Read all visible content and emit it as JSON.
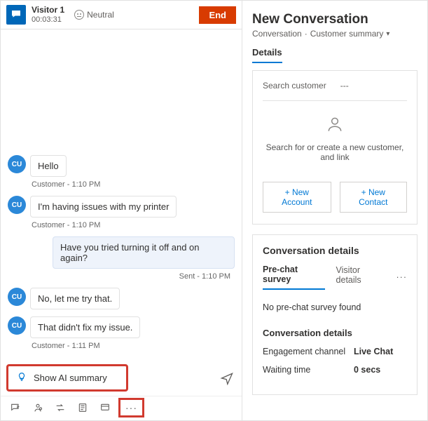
{
  "chat": {
    "visitor_name": "Visitor 1",
    "timer": "00:03:31",
    "sentiment": "Neutral",
    "end_label": "End",
    "messages": [
      {
        "side": "in",
        "avatar": "CU",
        "text": "Hello",
        "meta": "Customer - 1:10 PM"
      },
      {
        "side": "in",
        "avatar": "CU",
        "text": "I'm having issues with my printer",
        "meta": "Customer - 1:10 PM"
      },
      {
        "side": "out",
        "text": "Have you tried turning it off and on again?",
        "meta": "Sent - 1:10 PM"
      },
      {
        "side": "in",
        "avatar": "CU",
        "text": "No, let me try that.",
        "meta": ""
      },
      {
        "side": "in",
        "avatar": "CU",
        "text": "That didn't fix my issue.",
        "meta": "Customer - 1:11 PM"
      }
    ],
    "ai_summary_label": "Show AI summary"
  },
  "right": {
    "title": "New Conversation",
    "breadcrumb_a": "Conversation",
    "breadcrumb_b": "Customer summary",
    "details_tab": "Details",
    "search_customer_label": "Search customer",
    "search_customer_value": "---",
    "hint": "Search for or create a new customer, and link",
    "new_account": "+ New Account",
    "new_contact": "+ New Contact",
    "cd_title": "Conversation details",
    "tab_prechat": "Pre-chat survey",
    "tab_visitor": "Visitor details",
    "empty": "No pre-chat survey found",
    "cd_sec_title": "Conversation details",
    "kv": [
      {
        "k": "Engagement channel",
        "v": "Live Chat"
      },
      {
        "k": "Waiting time",
        "v": "0 secs"
      }
    ]
  }
}
